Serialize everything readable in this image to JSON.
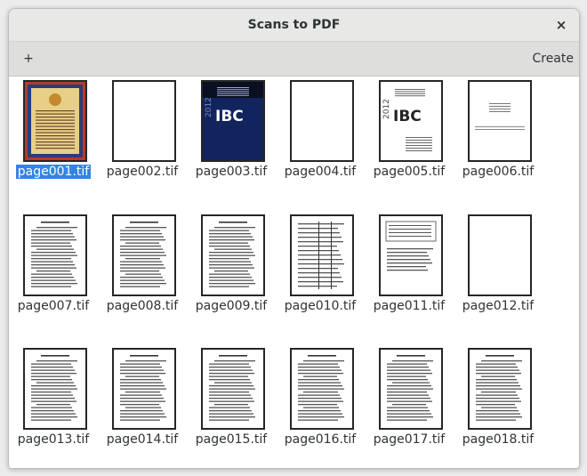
{
  "window": {
    "title": "Scans to PDF",
    "close_label": "×"
  },
  "toolbar": {
    "add_label": "+",
    "create_label": "Create"
  },
  "files": [
    {
      "name": "page001.tif",
      "thumb": "cover",
      "selected": true
    },
    {
      "name": "page002.tif",
      "thumb": "blank",
      "selected": false
    },
    {
      "name": "page003.tif",
      "thumb": "ibc-dark",
      "selected": false
    },
    {
      "name": "page004.tif",
      "thumb": "blank",
      "selected": false
    },
    {
      "name": "page005.tif",
      "thumb": "ibc-light",
      "selected": false
    },
    {
      "name": "page006.tif",
      "thumb": "sparse",
      "selected": false
    },
    {
      "name": "page007.tif",
      "thumb": "text",
      "selected": false
    },
    {
      "name": "page008.tif",
      "thumb": "text",
      "selected": false
    },
    {
      "name": "page009.tif",
      "thumb": "text",
      "selected": false
    },
    {
      "name": "page010.tif",
      "thumb": "table",
      "selected": false
    },
    {
      "name": "page011.tif",
      "thumb": "form",
      "selected": false
    },
    {
      "name": "page012.tif",
      "thumb": "blank",
      "selected": false
    },
    {
      "name": "page013.tif",
      "thumb": "text",
      "selected": false
    },
    {
      "name": "page014.tif",
      "thumb": "text",
      "selected": false
    },
    {
      "name": "page015.tif",
      "thumb": "text",
      "selected": false
    },
    {
      "name": "page016.tif",
      "thumb": "text",
      "selected": false
    },
    {
      "name": "page017.tif",
      "thumb": "text",
      "selected": false
    },
    {
      "name": "page018.tif",
      "thumb": "text",
      "selected": false
    }
  ],
  "thumb_text": {
    "year": "2012",
    "code": "IBC"
  },
  "colors": {
    "selection": "#3584e4",
    "cover_border": "#b53a2a",
    "cover_paper": "#e8cf87",
    "ibc_dark": "#12245e"
  }
}
